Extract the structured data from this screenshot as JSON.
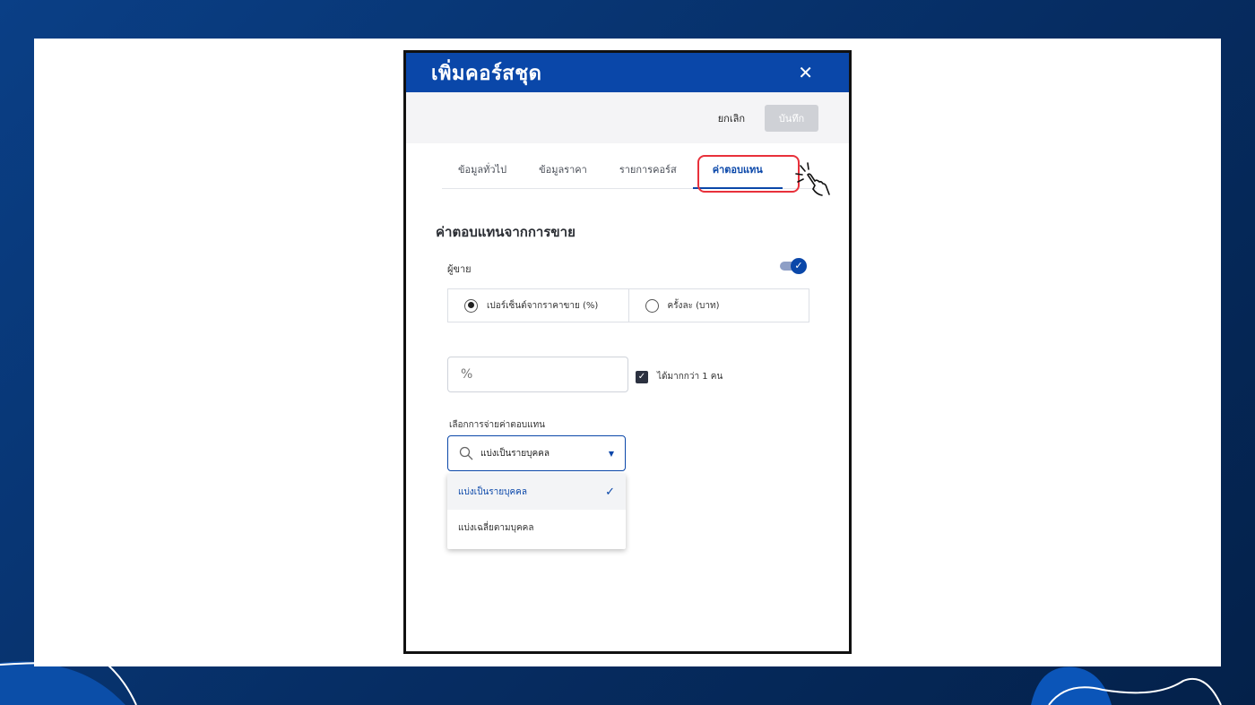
{
  "dialog": {
    "title": "เพิ่มคอร์สชุด",
    "close_icon": "close-icon"
  },
  "toolbar": {
    "cancel_label": "ยกเลิก",
    "save_label": "บันทึก"
  },
  "tabs": [
    {
      "label": "ข้อมูลทั่วไป",
      "active": false
    },
    {
      "label": "ข้อมูลราคา",
      "active": false
    },
    {
      "label": "รายการคอร์ส",
      "active": false
    },
    {
      "label": "ค่าตอบแทน",
      "active": true
    }
  ],
  "commission": {
    "section_title": "ค่าตอบแทนจากการขาย",
    "seller_label": "ผู้ขาย",
    "seller_enabled": true,
    "radio_options": [
      {
        "label": "เปอร์เซ็นต์จากราคาขาย (%)",
        "checked": true
      },
      {
        "label": "ครั้งละ (บาท)",
        "checked": false
      }
    ],
    "percent_placeholder": "%",
    "multi_checkbox_label": "ได้มากกว่า 1 คน",
    "multi_checked": true,
    "distribution_label": "เลือกการจ่ายค่าตอบแทน",
    "distribution_value": "แบ่งเป็นรายบุคคล",
    "dropdown_options": [
      {
        "label": "แบ่งเป็นรายบุคคล",
        "selected": true
      },
      {
        "label": "แบ่งเฉลี่ยตามบุคคล",
        "selected": false
      }
    ]
  },
  "colors": {
    "primary": "#0a47a9",
    "highlight": "#e8313b",
    "background": "#062d63"
  }
}
